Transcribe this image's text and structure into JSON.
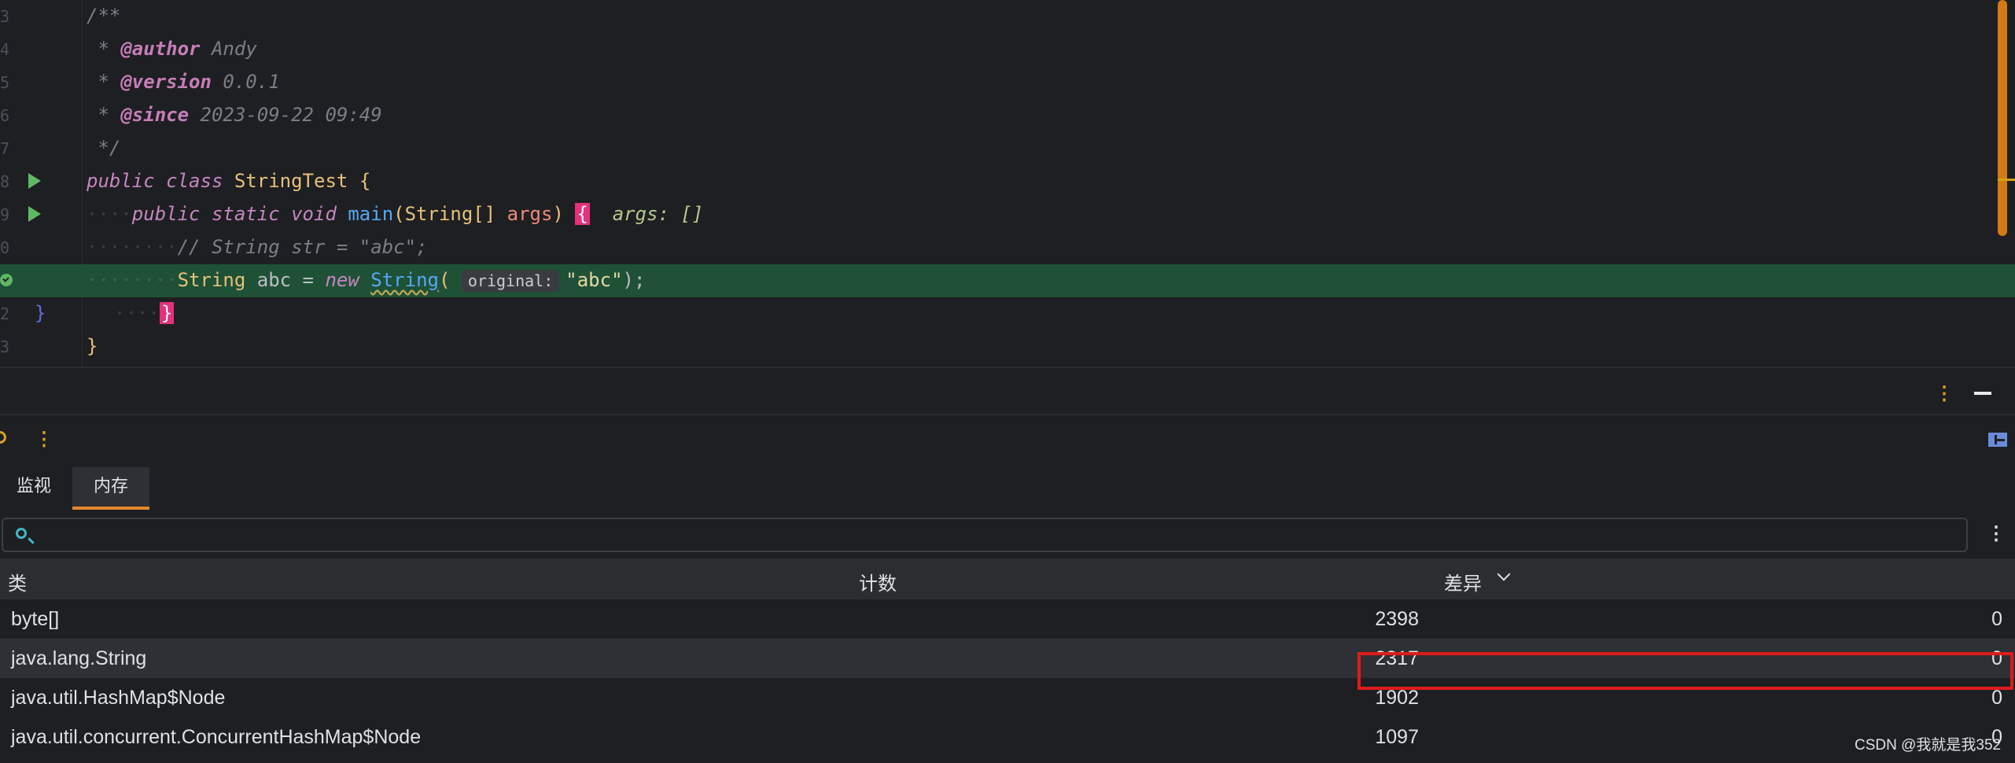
{
  "editor": {
    "line_numbers": [
      "3",
      "4",
      "5",
      "6",
      "7",
      "8",
      "9",
      "0",
      "",
      "2",
      "3"
    ],
    "doc_open": "/**",
    "author_tag": "@author",
    "author_value": "Andy",
    "version_tag": "@version",
    "version_value": "0.0.1",
    "since_tag": "@since",
    "since_value": "2023-09-22 09:49",
    "doc_close": "*/",
    "kw_public": "public",
    "kw_class": "class",
    "class_name": "StringTest",
    "kw_static": "static",
    "kw_void": "void",
    "method_name": "main",
    "param_type": "String[]",
    "param_name": "args",
    "inline_value": "args: []",
    "comment_line": "// String str = \"abc\";",
    "exec_type": "String",
    "exec_var": "abc",
    "kw_new": "new",
    "exec_ctor": "String",
    "param_hint": "original:",
    "exec_arg": "\"abc\"",
    "open_brace": "{",
    "close_brace": "}"
  },
  "tool_window": {
    "tabs": [
      {
        "label": "监视"
      },
      {
        "label": "内存"
      }
    ],
    "search": {
      "placeholder": ""
    },
    "columns": {
      "class": "类",
      "count": "计数",
      "diff": "差异"
    },
    "rows": [
      {
        "name": "byte[]",
        "count": "2398",
        "diff": "0"
      },
      {
        "name": "java.lang.String",
        "count": "2317",
        "diff": "0"
      },
      {
        "name": "java.util.HashMap$Node",
        "count": "1902",
        "diff": "0"
      },
      {
        "name": "java.util.concurrent.ConcurrentHashMap$Node",
        "count": "1097",
        "diff": "0"
      }
    ]
  },
  "watermark": "CSDN @我就是我352",
  "colors": {
    "accent_tab": "#e5852b",
    "exec_line": "#1f5137",
    "highlight_box": "#e01b1b"
  }
}
